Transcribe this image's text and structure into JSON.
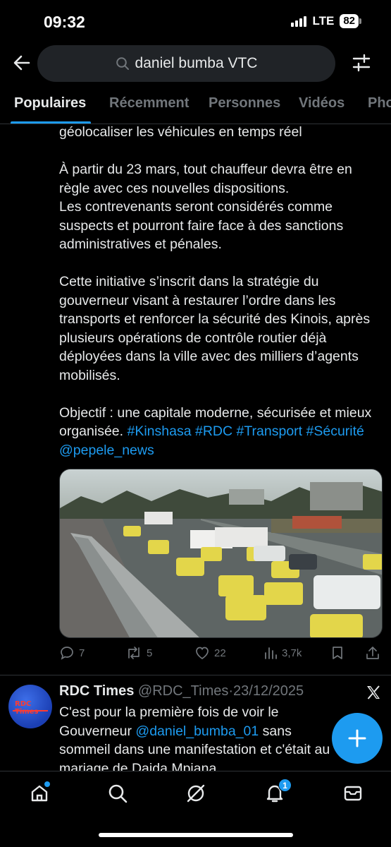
{
  "status_bar": {
    "time": "09:32",
    "network": "LTE",
    "battery": "82"
  },
  "search": {
    "query": "daniel bumba VTC",
    "icon": "search-icon"
  },
  "tabs": [
    {
      "label": "Populaires",
      "active": true
    },
    {
      "label": "Récemment",
      "active": false
    },
    {
      "label": "Personnes",
      "active": false
    },
    {
      "label": "Vidéos",
      "active": false
    },
    {
      "label": "Photos",
      "active": false
    }
  ],
  "tweet": {
    "para1": "géolocaliser les véhicules en temps réel",
    "para2_line1": "À partir du 23 mars, tout chauffeur devra être en règle avec ces nouvelles dispositions.",
    "para2_line2": "Les contrevenants seront considérés comme suspects et pourront faire face à des sanctions administratives et pénales.",
    "para3": "Cette initiative s’inscrit dans la stratégie du gouverneur visant à restaurer l’ordre dans les transports et renforcer la sécurité des Kinois, après plusieurs opérations de contrôle routier déjà déployées dans la ville avec des milliers d’agents mobilisés.",
    "para4": "Objectif : une capitale moderne, sécurisée et mieux organisée.",
    "tags": [
      "#Kinshasa",
      "#RDC",
      "#Transport",
      "#Sécurité",
      "@pepele_news"
    ],
    "media_alt": "Embouteillage de taxis jaunes sur une avenue de Kinshasa",
    "stats": {
      "replies": "7",
      "reposts": "5",
      "likes": "22",
      "views": "3,7k"
    }
  },
  "tweet2": {
    "avatar_text": "RDC Times",
    "name": "RDC Times",
    "handle": "@RDC_Times",
    "sep": "·",
    "date": "23/12/2025",
    "text_a": "C'est pour la première fois de voir le Gouverneur ",
    "mention": "@daniel_bumba_01",
    "text_b": " sans sommeil dans une manifestation et c'était au mariage de Daida Mpiana"
  },
  "nav": {
    "notifications_count": "1",
    "items": [
      "home-icon",
      "search-icon",
      "grok-icon",
      "notifications-icon",
      "messages-icon"
    ]
  },
  "colors": {
    "accent": "#1d9bf0",
    "background": "#000000",
    "text": "#e7e9ea",
    "muted": "#71767b"
  }
}
